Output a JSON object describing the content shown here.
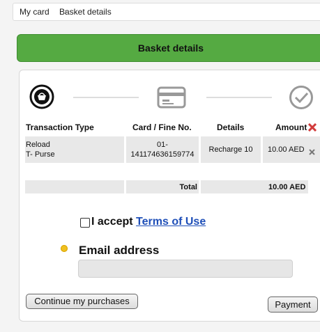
{
  "breadcrumb": {
    "items": [
      "My card",
      "Basket details"
    ],
    "separator": "›"
  },
  "banner": {
    "title": "Basket details",
    "color": "#55aa42"
  },
  "steps": {
    "icons": [
      "basket-icon",
      "card-icon",
      "checkmark-icon"
    ],
    "active_index": 0
  },
  "table": {
    "headers": {
      "type": "Transaction Type",
      "card": "Card / Fine No.",
      "details": "Details",
      "amount": "Amount"
    },
    "rows": [
      {
        "type_line1": "Reload",
        "type_line2": "T- Purse",
        "card_line1": "01-",
        "card_line2": "141174636159774",
        "details": "Recharge 10",
        "amount": "10.00 AED"
      }
    ],
    "total_label": "Total",
    "total_value": "10.00 AED"
  },
  "terms": {
    "prefix": "I accept ",
    "link": "Terms of Use",
    "checked": false
  },
  "email": {
    "label": "Email address",
    "value": ""
  },
  "buttons": {
    "continue": "Continue my purchases",
    "payment": "Payment"
  }
}
